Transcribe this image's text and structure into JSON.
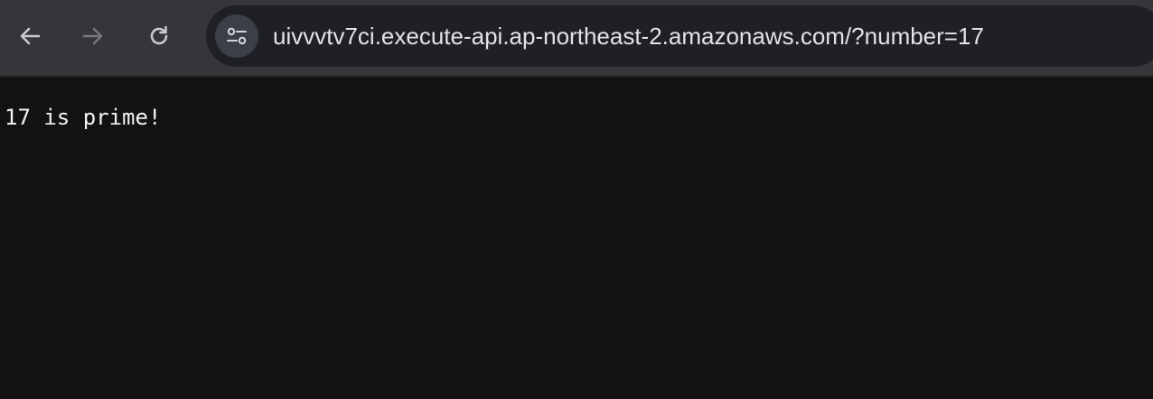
{
  "browser": {
    "toolbar": {
      "back_icon": "arrow-left-icon",
      "forward_icon": "arrow-right-icon",
      "reload_icon": "reload-icon"
    },
    "address_bar": {
      "site_info_icon": "tune-icon",
      "url": "uivvvtv7ci.execute-api.ap-northeast-2.amazonaws.com/?number=17"
    }
  },
  "page": {
    "body_text": "17 is prime!"
  },
  "colors": {
    "toolbar_bg": "#35363a",
    "omnibox_bg": "#1e2026",
    "page_bg": "#121212",
    "text": "#f2f2f2"
  }
}
